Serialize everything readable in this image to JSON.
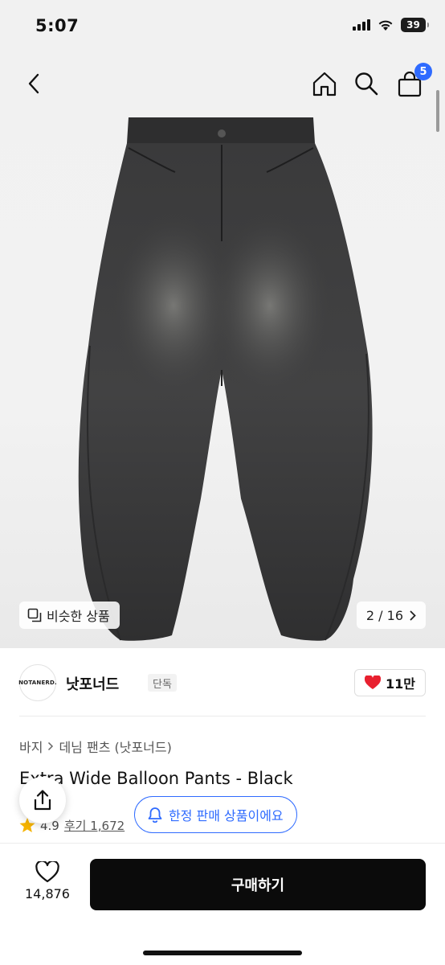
{
  "status_bar": {
    "time": "5:07",
    "battery": "39"
  },
  "nav": {
    "cart_count": "5"
  },
  "gallery": {
    "similar_label": "비슷한 상품",
    "counter": "2 / 16"
  },
  "brand": {
    "logo_text": "NOTANERD.",
    "name": "낫포너드",
    "tag": "단독",
    "likes": "11만"
  },
  "breadcrumb": {
    "category": "바지",
    "subcategory": "데님 팬츠 (낫포너드)"
  },
  "product": {
    "title": "Extra Wide Balloon Pants - Black",
    "rating": "4.9",
    "reviews": "후기 1,672"
  },
  "limited_notice": "한정 판매 상품이에요",
  "bottom": {
    "wish_count": "14,876",
    "buy_label": "구매하기"
  },
  "colors": {
    "accent": "#2f6bff",
    "like": "#e8202f",
    "buy_bg": "#0b0b0b",
    "star": "#f5b301"
  }
}
